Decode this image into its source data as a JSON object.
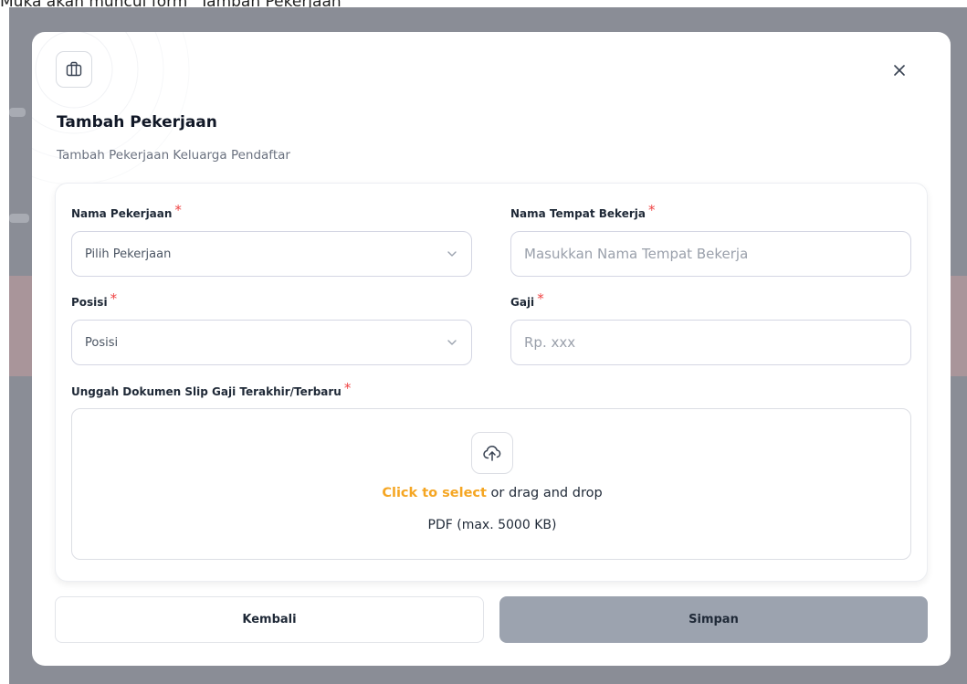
{
  "page_caption": "Muka akan muncul form \"Tambah Pekerjaan\"",
  "modal": {
    "title": "Tambah Pekerjaan",
    "subtitle": "Tambah Pekerjaan Keluarga Pendaftar",
    "header_icon": "briefcase-icon",
    "close_icon": "close-icon"
  },
  "form": {
    "nama_pekerjaan": {
      "label": "Nama Pekerjaan",
      "required_mark": "*",
      "value": "Pilih Pekerjaan"
    },
    "nama_tempat_bekerja": {
      "label": "Nama Tempat Bekerja",
      "required_mark": "*",
      "placeholder": "Masukkan Nama Tempat Bekerja"
    },
    "posisi": {
      "label": "Posisi",
      "required_mark": "*",
      "value": "Posisi"
    },
    "gaji": {
      "label": "Gaji",
      "required_mark": "*",
      "placeholder": "Rp. xxx"
    },
    "upload": {
      "label": "Unggah Dokumen Slip Gaji Terakhir/Terbaru",
      "required_mark": "*",
      "link_text": "Click to select",
      "rest_text": " or drag and drop",
      "hint": "PDF (max. 5000 KB)",
      "icon": "upload-cloud-icon"
    }
  },
  "actions": {
    "back_label": "Kembali",
    "save_label": "Simpan"
  },
  "colors": {
    "accent": "#f5a623",
    "required": "#ef4444",
    "save_button_disabled": "#9ca3af",
    "backdrop": "#8a8d96"
  }
}
